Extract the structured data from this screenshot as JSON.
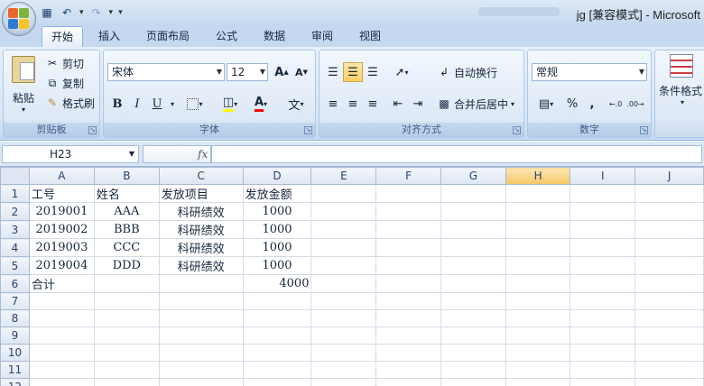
{
  "qat": {
    "save_icon": "save-icon",
    "undo_icon": "undo-icon",
    "redo_icon": "redo-icon"
  },
  "window": {
    "title": "jg  [兼容模式] - Microsoft"
  },
  "tabs": [
    "开始",
    "插入",
    "页面布局",
    "公式",
    "数据",
    "审阅",
    "视图"
  ],
  "clipboard": {
    "paste": "粘贴",
    "cut": "剪切",
    "copy": "复制",
    "format_painter": "格式刷",
    "label": "剪贴板"
  },
  "font": {
    "name": "宋体",
    "size": "12",
    "label": "字体",
    "bold": "B",
    "italic": "I",
    "underline": "U",
    "grow": "A",
    "shrink": "A",
    "font_color": "A",
    "phonetic": "文"
  },
  "alignment": {
    "wrap": "自动换行",
    "merge": "合并后居中",
    "label": "对齐方式"
  },
  "number": {
    "format": "常规",
    "percent": "%",
    "comma": ",",
    "inc_decimal": ".0→.00",
    "dec_decimal": ".00→.0",
    "label": "数字"
  },
  "styles": {
    "conditional": "条件格式"
  },
  "formula_bar": {
    "namebox": "H23",
    "fx": "fx",
    "formula": ""
  },
  "columns": [
    "A",
    "B",
    "C",
    "D",
    "E",
    "F",
    "G",
    "H",
    "I",
    "J"
  ],
  "selected_column": "H",
  "rows": [
    {
      "n": "1",
      "cells": [
        "工号",
        "姓名",
        "发放项目",
        "发放金额",
        "",
        "",
        "",
        "",
        "",
        ""
      ]
    },
    {
      "n": "2",
      "cells": [
        "2019001",
        "AAA",
        "科研绩效",
        "1000",
        "",
        "",
        "",
        "",
        "",
        ""
      ]
    },
    {
      "n": "3",
      "cells": [
        "2019002",
        "BBB",
        "科研绩效",
        "1000",
        "",
        "",
        "",
        "",
        "",
        ""
      ]
    },
    {
      "n": "4",
      "cells": [
        "2019003",
        "CCC",
        "科研绩效",
        "1000",
        "",
        "",
        "",
        "",
        "",
        ""
      ]
    },
    {
      "n": "5",
      "cells": [
        "2019004",
        "DDD",
        "科研绩效",
        "1000",
        "",
        "",
        "",
        "",
        "",
        ""
      ]
    },
    {
      "n": "6",
      "cells": [
        "合计",
        "",
        "",
        "4000",
        "",
        "",
        "",
        "",
        "",
        ""
      ]
    },
    {
      "n": "7",
      "cells": [
        "",
        "",
        "",
        "",
        "",
        "",
        "",
        "",
        "",
        ""
      ]
    },
    {
      "n": "8",
      "cells": [
        "",
        "",
        "",
        "",
        "",
        "",
        "",
        "",
        "",
        ""
      ]
    },
    {
      "n": "9",
      "cells": [
        "",
        "",
        "",
        "",
        "",
        "",
        "",
        "",
        "",
        ""
      ]
    },
    {
      "n": "10",
      "cells": [
        "",
        "",
        "",
        "",
        "",
        "",
        "",
        "",
        "",
        ""
      ]
    },
    {
      "n": "11",
      "cells": [
        "",
        "",
        "",
        "",
        "",
        "",
        "",
        "",
        "",
        ""
      ]
    },
    {
      "n": "12",
      "cells": [
        "",
        "",
        "",
        "",
        "",
        "",
        "",
        "",
        "",
        ""
      ]
    }
  ]
}
